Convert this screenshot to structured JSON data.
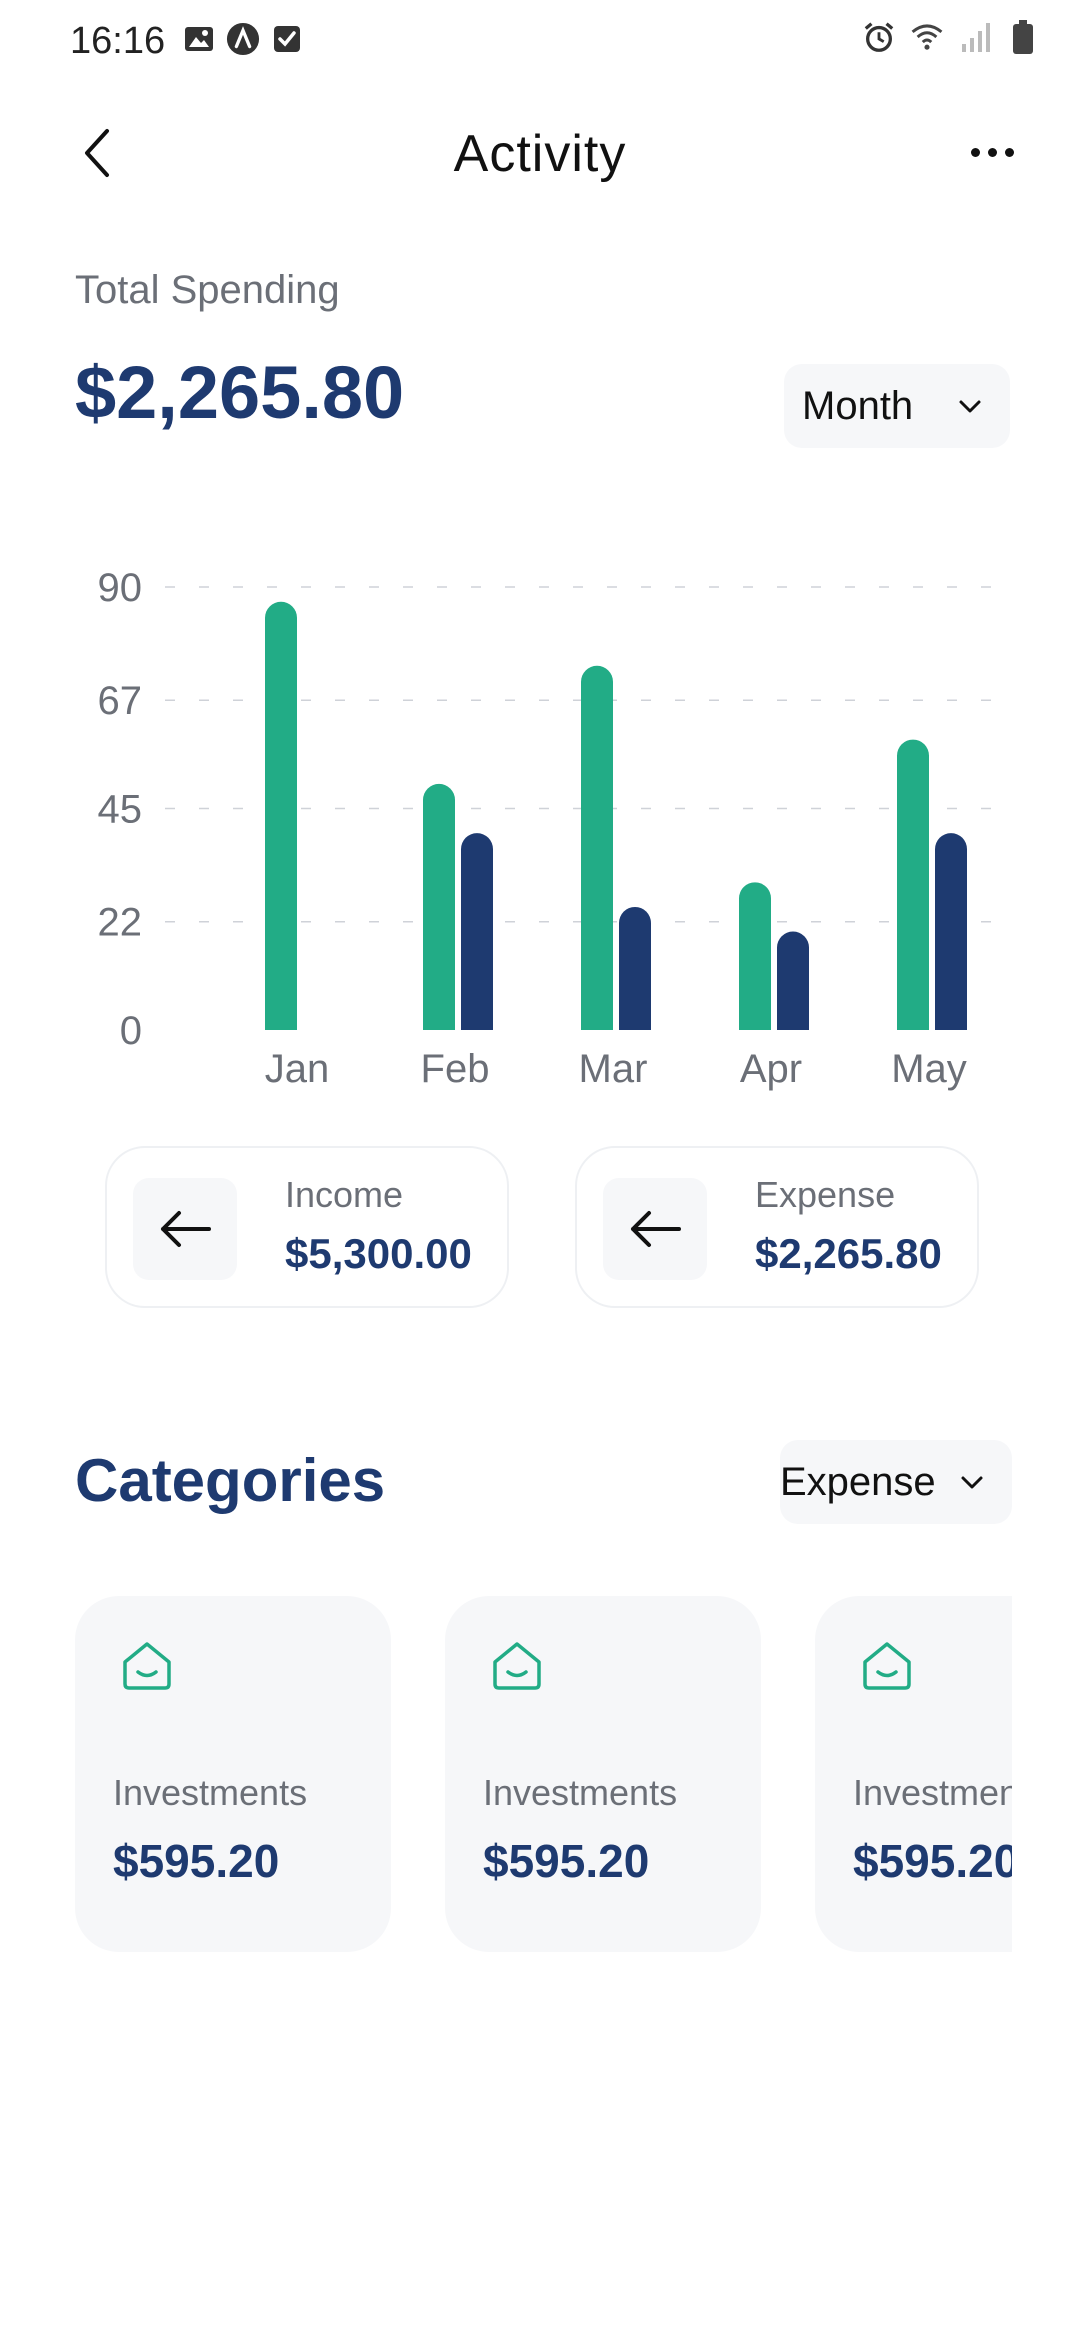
{
  "status_bar": {
    "time": "16:16",
    "left_icons": [
      "image-icon",
      "app-badge-icon",
      "checkbox-icon"
    ],
    "right_icons": [
      "alarm-icon",
      "wifi-icon",
      "signal-icon",
      "battery-icon"
    ]
  },
  "header": {
    "title": "Activity",
    "back_icon": "chevron-left-icon",
    "more_icon": "more-horizontal-icon"
  },
  "summary": {
    "label": "Total Spending",
    "amount": "$2,265.80",
    "period": "Month"
  },
  "chart_data": {
    "type": "bar",
    "categories": [
      "Jan",
      "Feb",
      "Mar",
      "Apr",
      "May"
    ],
    "series": [
      {
        "values": [
          87,
          50,
          74,
          30,
          59
        ],
        "color": "#22ac86"
      },
      {
        "values": [
          0,
          40,
          25,
          20,
          40
        ],
        "color": "#1e3a70"
      }
    ],
    "yticks": [
      "90",
      "67",
      "45",
      "22",
      "0"
    ],
    "ylim": [
      0,
      90
    ],
    "grid": "dashed horizontal"
  },
  "stats": {
    "income": {
      "label": "Income",
      "value": "$5,300.00",
      "icon": "arrow-left-icon"
    },
    "expense": {
      "label": "Expense",
      "value": "$2,265.80",
      "icon": "arrow-left-icon"
    }
  },
  "categories": {
    "title": "Categories",
    "filter": "Expense",
    "items": [
      {
        "name": "Investments",
        "amount": "$595.20",
        "icon": "home-icon"
      },
      {
        "name": "Investments",
        "amount": "$595.20",
        "icon": "home-icon"
      },
      {
        "name": "Investments",
        "amount": "$595.20",
        "icon": "home-icon"
      }
    ]
  },
  "colors": {
    "accent_green": "#22ac86",
    "accent_navy": "#1e3a70",
    "muted_text": "#6b6f77",
    "card_bg": "#f6f7f9"
  }
}
